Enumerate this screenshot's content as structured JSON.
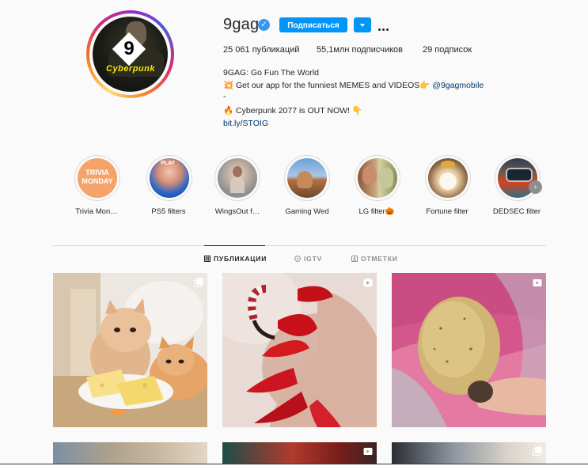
{
  "profile": {
    "username": "9gag",
    "follow_label": "Подписаться",
    "stats": {
      "posts": "25 061 публикаций",
      "followers": "55,1млн подписчиков",
      "following": "29 подписок"
    },
    "avatar_text": "Cyberpunk",
    "avatar_logo": "9",
    "bio": {
      "name": "9GAG: Go Fun The World",
      "line1_icon": "💥",
      "line1": "Get our app for the funniest MEMES and VIDEOS",
      "line1_emoji": "👉",
      "line1_mention": "@9gagmobile",
      "dash": "-",
      "line3_icon": "🔥",
      "line3": "Cyberpunk 2077 is OUT NOW!",
      "line3_emoji": "👇",
      "link": "bit.ly/STOIG"
    }
  },
  "highlights": [
    {
      "label": "Trivia Mon…",
      "cover_text": "TRIVIA MONDAY"
    },
    {
      "label": "PS5 filters",
      "cover_text": "PLAY"
    },
    {
      "label": "WingsOut f…"
    },
    {
      "label": "Gaming Wed"
    },
    {
      "label": "LG filter🎃"
    },
    {
      "label": "Fortune filter"
    },
    {
      "label": "DEDSEC filter"
    }
  ],
  "tabs": [
    {
      "label": "ПУБЛИКАЦИИ",
      "icon": "grid-icon",
      "active": true
    },
    {
      "label": "IGTV",
      "icon": "igtv-icon",
      "active": false
    },
    {
      "label": "ОТМЕТКИ",
      "icon": "tag-icon",
      "active": false
    }
  ],
  "posts": [
    {
      "type": "carousel-icon",
      "subject": "cats with cheese"
    },
    {
      "type": "igtv-icon",
      "subject": "red nails"
    },
    {
      "type": "video-icon",
      "subject": "potato"
    },
    {
      "type": "none",
      "subject": ""
    },
    {
      "type": "video-icon",
      "subject": ""
    },
    {
      "type": "carousel-icon",
      "subject": ""
    }
  ],
  "colors": {
    "accent": "#0095f6",
    "link": "#00376b",
    "text": "#262626",
    "muted": "#8e8e8e",
    "border": "#dbdbdb"
  }
}
